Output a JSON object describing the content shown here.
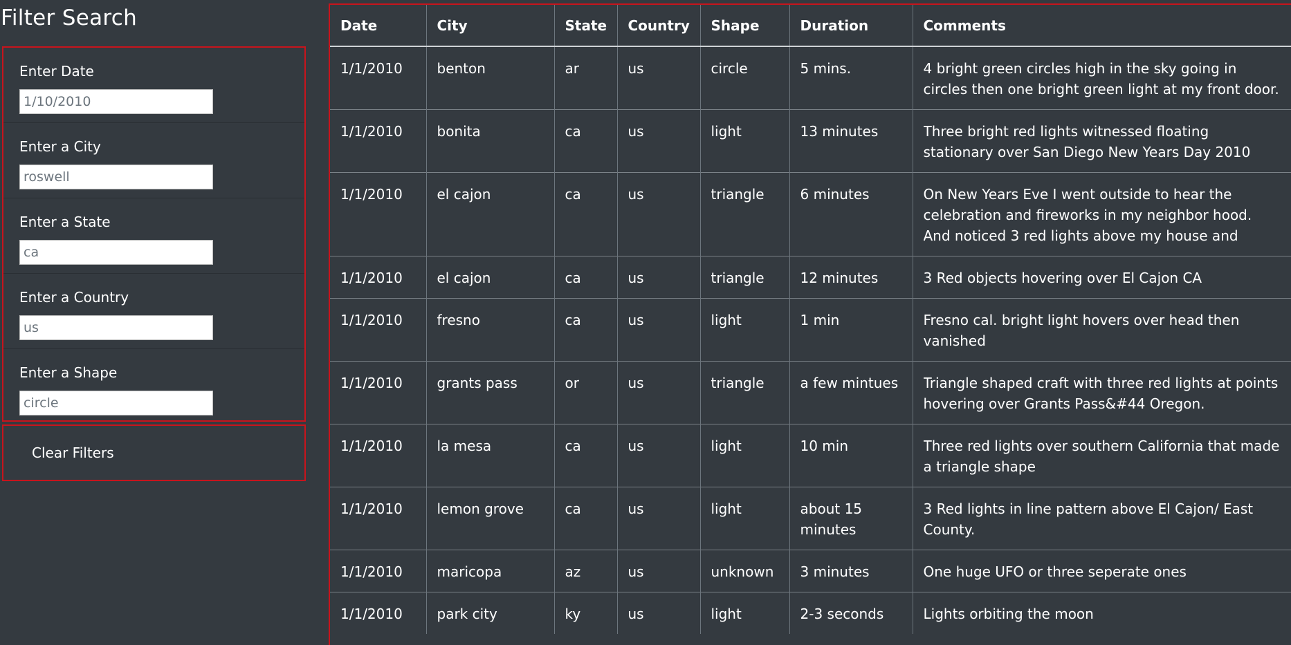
{
  "sidebar": {
    "title": "Filter Search",
    "filters": [
      {
        "label": "Enter Date",
        "placeholder": "1/10/2010"
      },
      {
        "label": "Enter a City",
        "placeholder": "roswell"
      },
      {
        "label": "Enter a State",
        "placeholder": "ca"
      },
      {
        "label": "Enter a Country",
        "placeholder": "us"
      },
      {
        "label": "Enter a Shape",
        "placeholder": "circle"
      }
    ],
    "clear_label": "Clear Filters"
  },
  "colors": {
    "background": "#343a40",
    "highlight_border": "#c8141c",
    "text": "#ffffff"
  },
  "table": {
    "headers": [
      "Date",
      "City",
      "State",
      "Country",
      "Shape",
      "Duration",
      "Comments"
    ],
    "rows": [
      [
        "1/1/2010",
        "benton",
        "ar",
        "us",
        "circle",
        "5 mins.",
        "4 bright green circles high in the sky going in circles then one bright green light at my front door."
      ],
      [
        "1/1/2010",
        "bonita",
        "ca",
        "us",
        "light",
        "13 minutes",
        "Three bright red lights witnessed floating stationary over San Diego New Years Day 2010"
      ],
      [
        "1/1/2010",
        "el cajon",
        "ca",
        "us",
        "triangle",
        "6 minutes",
        "On New Years Eve I went outside to hear the celebration and fireworks in my neighbor hood. And noticed 3 red lights above my house and"
      ],
      [
        "1/1/2010",
        "el cajon",
        "ca",
        "us",
        "triangle",
        "12 minutes",
        "3 Red objects hovering over El Cajon CA"
      ],
      [
        "1/1/2010",
        "fresno",
        "ca",
        "us",
        "light",
        "1 min",
        "Fresno cal. bright light hovers over head then vanished"
      ],
      [
        "1/1/2010",
        "grants pass",
        "or",
        "us",
        "triangle",
        "a few mintues",
        "Triangle shaped craft with three red lights at points hovering over Grants Pass&#44 Oregon."
      ],
      [
        "1/1/2010",
        "la mesa",
        "ca",
        "us",
        "light",
        "10 min",
        "Three red lights over southern California that made a triangle shape"
      ],
      [
        "1/1/2010",
        "lemon grove",
        "ca",
        "us",
        "light",
        "about 15 minutes",
        "3 Red lights in line pattern above El Cajon/ East County."
      ],
      [
        "1/1/2010",
        "maricopa",
        "az",
        "us",
        "unknown",
        "3 minutes",
        "One huge UFO or three seperate ones"
      ],
      [
        "1/1/2010",
        "park city",
        "ky",
        "us",
        "light",
        "2-3 seconds",
        "Lights orbiting the moon"
      ]
    ]
  }
}
